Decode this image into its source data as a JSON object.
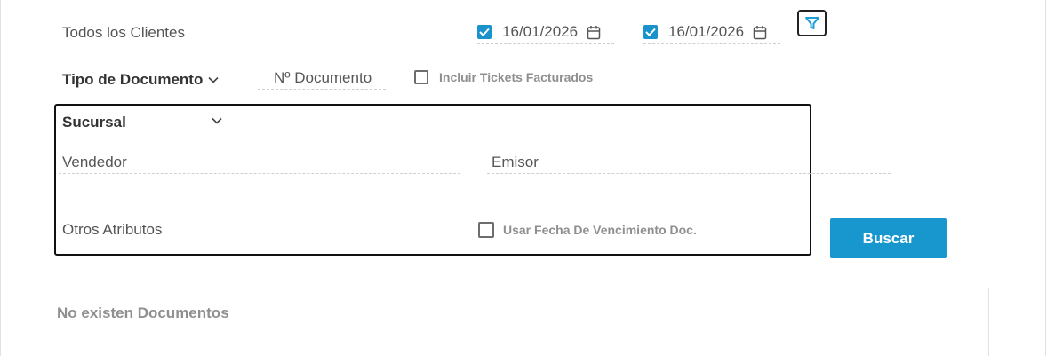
{
  "filters": {
    "clients_placeholder": "Todos los Clientes",
    "date_from": {
      "checked": true,
      "value": "16/01/2026"
    },
    "date_to": {
      "checked": true,
      "value": "16/01/2026"
    },
    "doc_type_label": "Tipo de Documento",
    "doc_number_placeholder": "Nº Documento",
    "include_tickets_label": "Incluir Tickets Facturados",
    "include_tickets_checked": false,
    "branch_label": "Sucursal",
    "seller_placeholder": "Vendedor",
    "issuer_placeholder": "Emisor",
    "other_attributes_placeholder": "Otros Atributos",
    "use_due_date_label": "Usar Fecha De Vencimiento Doc.",
    "use_due_date_checked": false,
    "search_button_label": "Buscar"
  },
  "results": {
    "empty_message": "No existen Documentos"
  },
  "icons": {
    "calendar": "calendar-icon",
    "filter": "filter-icon",
    "chevron": "chevron-down-icon",
    "check": "check-icon"
  },
  "colors": {
    "accent": "#1897cf",
    "checkbox_checked": "#1a92cc",
    "filter_icon": "#1a9fd6"
  }
}
